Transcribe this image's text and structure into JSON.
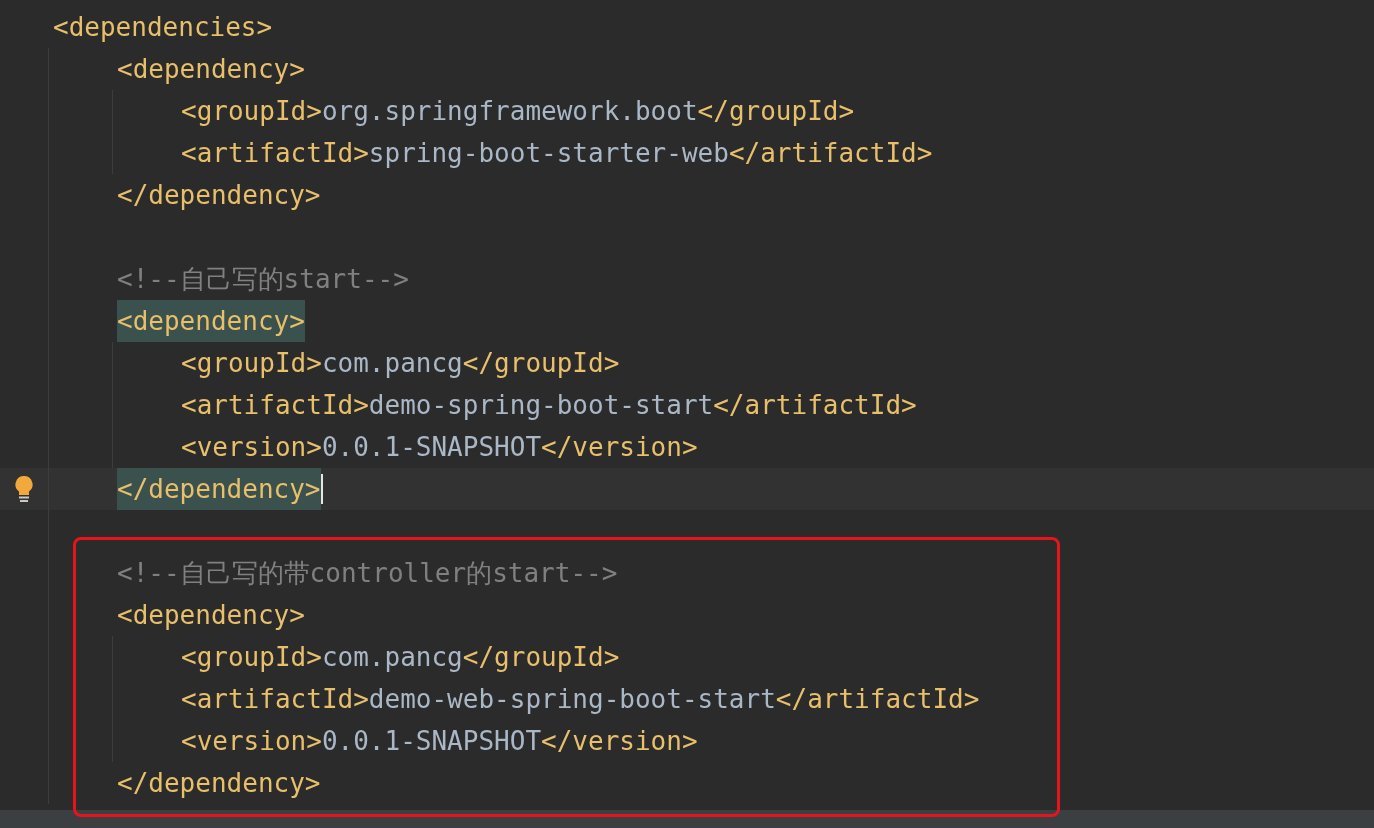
{
  "code": {
    "lines": [
      {
        "kind": "tag",
        "open": "<dependencies>",
        "highlighted": false,
        "current": false,
        "children": [
          {
            "kind": "tag",
            "open": "<dependency>",
            "highlighted": false,
            "current": false,
            "children": [
              {
                "kind": "element",
                "open": "<groupId>",
                "value": "org.springframework.boot",
                "close": "</groupId>",
                "current": false
              },
              {
                "kind": "element",
                "open": "<artifactId>",
                "value": "spring-boot-starter-web",
                "close": "</artifactId>",
                "current": false
              }
            ]
          },
          {
            "kind": "tag",
            "open": "</dependency>",
            "highlighted": false,
            "current": false
          },
          {
            "kind": "blank",
            "current": false
          },
          {
            "kind": "comment",
            "text": "<!--自己写的start-->",
            "current": false
          },
          {
            "kind": "tag",
            "open": "<dependency>",
            "highlighted": true,
            "current": false,
            "children": [
              {
                "kind": "element",
                "open": "<groupId>",
                "value": "com.pancg",
                "close": "</groupId>",
                "current": false
              },
              {
                "kind": "element",
                "open": "<artifactId>",
                "value": "demo-spring-boot-start",
                "close": "</artifactId>",
                "current": false
              },
              {
                "kind": "element",
                "open": "<version>",
                "value": "0.0.1-SNAPSHOT",
                "close": "</version>",
                "current": false
              }
            ]
          },
          {
            "kind": "tag",
            "open": "</dependency>",
            "highlighted": true,
            "current": true
          },
          {
            "kind": "blank",
            "current": false
          },
          {
            "kind": "boxed_group",
            "children": [
              {
                "kind": "comment",
                "text": "<!--自己写的带controller的start-->",
                "current": false
              },
              {
                "kind": "tag",
                "open": "<dependency>",
                "highlighted": false,
                "current": false,
                "children": [
                  {
                    "kind": "element",
                    "open": "<groupId>",
                    "value": "com.pancg",
                    "close": "</groupId>",
                    "current": false
                  },
                  {
                    "kind": "element",
                    "open": "<artifactId>",
                    "value": "demo-web-spring-boot-start",
                    "close": "</artifactId>",
                    "current": false
                  },
                  {
                    "kind": "element",
                    "open": "<version>",
                    "value": "0.0.1-SNAPSHOT",
                    "close": "</version>",
                    "current": false
                  }
                ]
              },
              {
                "kind": "tag",
                "open": "</dependency>",
                "highlighted": false,
                "current": false
              }
            ]
          }
        ]
      }
    ]
  }
}
